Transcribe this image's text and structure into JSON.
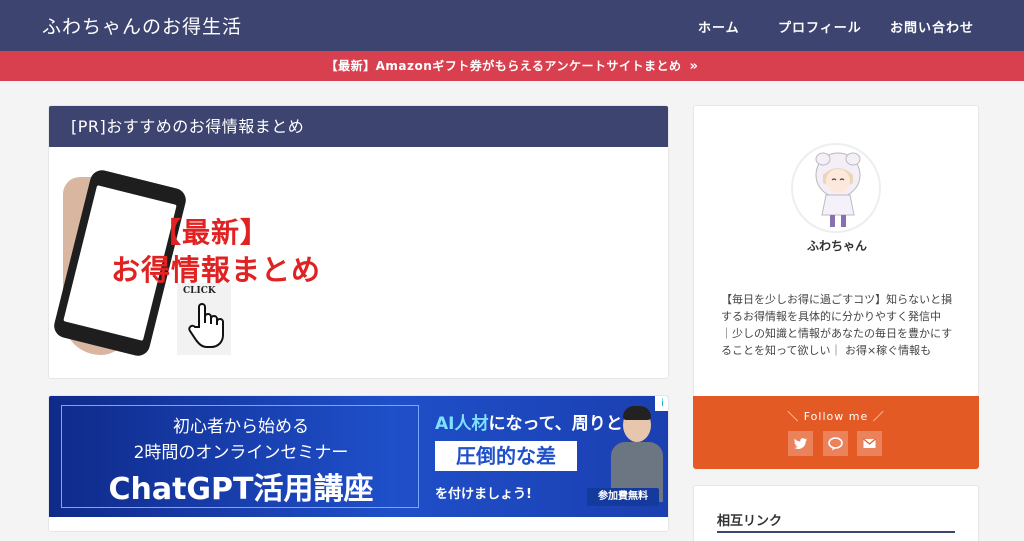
{
  "header": {
    "site_title": "ふわちゃんのお得生活",
    "nav": [
      "ホーム",
      "プロフィール",
      "お問い合わせ"
    ]
  },
  "notice": {
    "text": "【最新】Amazonギフト券がもらえるアンケートサイトまとめ",
    "chevron": "»"
  },
  "pr_card": {
    "title": "[PR]おすすめのお得情報まとめ",
    "promo_line1": "【最新】",
    "promo_line2": "お得情報まとめ",
    "click": "CLICK"
  },
  "ad": {
    "line1": "初心者から始める",
    "line2": "2時間のオンラインセミナー",
    "line3": "ChatGPT活用講座",
    "right_hl": "AI人材",
    "right_rest": "になって、周りと",
    "right_box": "圧倒的な差",
    "right_line3": "を付けましょう!",
    "badge": "参加費無料",
    "choice": "i"
  },
  "profile": {
    "name": "ふわちゃん",
    "description": "【毎日を少しお得に過ごすコツ】知らないと損するお得情報を具体的に分かりやすく発信中 ｜少しの知識と情報があなたの毎日を豊かにすることを知って欲しい｜ お得×稼ぐ情報も"
  },
  "follow": {
    "label": "＼ Follow me ／",
    "icons": [
      "twitter-icon",
      "line-icon",
      "mail-icon"
    ]
  },
  "links": {
    "title": "相互リンク"
  },
  "colors": {
    "header": "#3d4470",
    "notice": "#d9404f",
    "follow": "#e35a24",
    "promo_red": "#e02222"
  }
}
